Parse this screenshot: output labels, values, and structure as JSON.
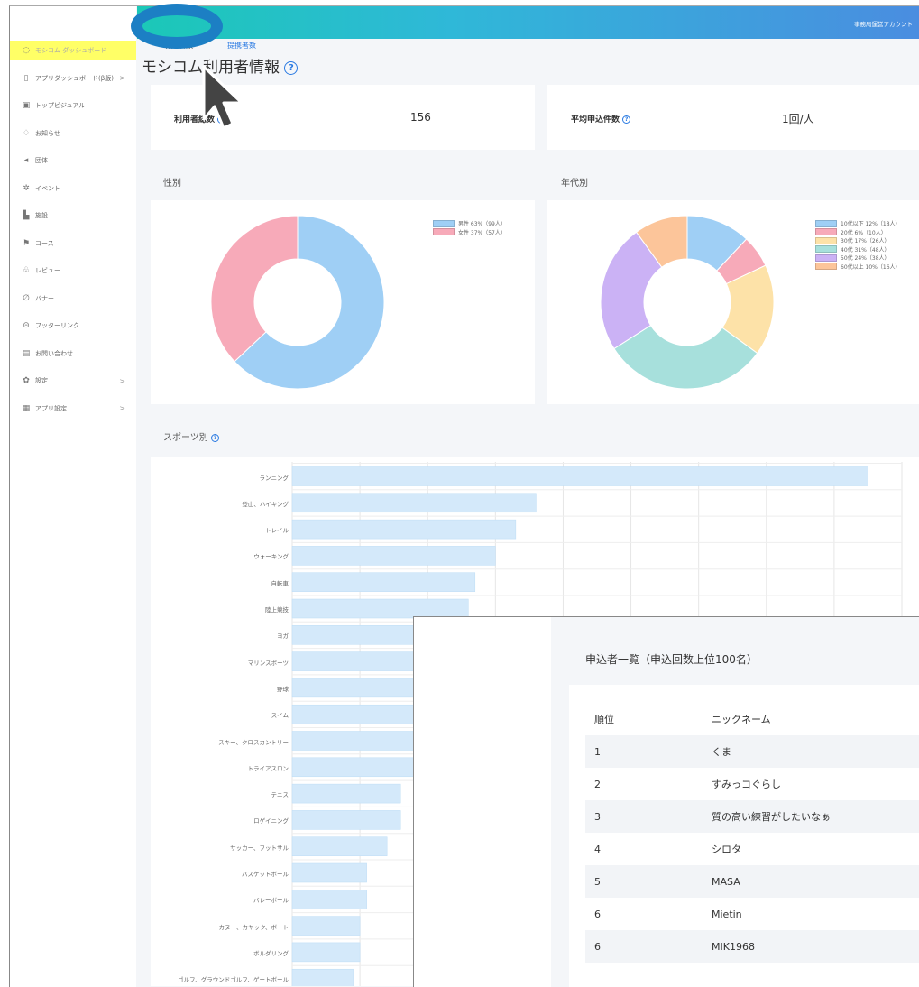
{
  "header": {
    "account": "事務局運営アカウント"
  },
  "tabs": [
    "利用者数",
    "提携者数"
  ],
  "sidebar": {
    "items": [
      {
        "label": "モシコム ダッシュボード",
        "icon": "dashboard-icon",
        "active": true
      },
      {
        "label": "アプリダッシュボード(β版)",
        "icon": "mobile-icon",
        "chevron": ">"
      },
      {
        "label": "トップビジュアル",
        "icon": "image-icon"
      },
      {
        "label": "お知らせ",
        "icon": "bell-icon"
      },
      {
        "label": "団体",
        "icon": "megaphone-icon"
      },
      {
        "label": "イベント",
        "icon": "event-icon"
      },
      {
        "label": "施設",
        "icon": "building-icon"
      },
      {
        "label": "コース",
        "icon": "flag-icon"
      },
      {
        "label": "レビュー",
        "icon": "thumbs-up-icon"
      },
      {
        "label": "バナー",
        "icon": "clip-icon"
      },
      {
        "label": "フッターリンク",
        "icon": "link-icon"
      },
      {
        "label": "お問い合わせ",
        "icon": "mail-icon"
      },
      {
        "label": "設定",
        "icon": "gear-icon",
        "chevron": ">"
      },
      {
        "label": "アプリ設定",
        "icon": "grid-icon",
        "chevron": ">"
      }
    ]
  },
  "page": {
    "title": "モシコム利用者情報"
  },
  "stats": {
    "total_label": "利用者総数",
    "total_value": "156",
    "avg_label": "平均申込件数",
    "avg_value": "1回/人"
  },
  "sections": {
    "gender": "性別",
    "age": "年代別",
    "sports": "スポーツ別"
  },
  "colors": {
    "male": "#9fcff5",
    "female": "#f7aab9",
    "teen": "#9fcff5",
    "twenties": "#f7aab9",
    "thirties": "#fde2a8",
    "forties": "#a7e0dc",
    "fifties": "#cbb2f5",
    "sixties": "#fcc59a"
  },
  "chart_data": [
    {
      "type": "pie",
      "title": "性別",
      "categories": [
        "男性",
        "女性"
      ],
      "values": [
        63,
        37
      ],
      "counts": [
        99,
        57
      ],
      "legend": [
        "男性 63%（99人）",
        "女性 37%（57人）"
      ],
      "colors": [
        "#9fcff5",
        "#f7aab9"
      ]
    },
    {
      "type": "pie",
      "title": "年代別",
      "categories": [
        "10代以下",
        "20代",
        "30代",
        "40代",
        "50代",
        "60代以上"
      ],
      "values": [
        12,
        6,
        17,
        31,
        24,
        10
      ],
      "counts": [
        18,
        10,
        26,
        48,
        38,
        16
      ],
      "legend": [
        "10代以下 12%（18人）",
        "20代 6%（10人）",
        "30代 17%（26人）",
        "40代 31%（48人）",
        "50代 24%（38人）",
        "60代以上 10%（16人）"
      ],
      "colors": [
        "#9fcff5",
        "#f7aab9",
        "#fde2a8",
        "#a7e0dc",
        "#cbb2f5",
        "#fcc59a"
      ]
    },
    {
      "type": "bar",
      "title": "スポーツ別",
      "orientation": "horizontal",
      "categories": [
        "ランニング",
        "登山、ハイキング",
        "トレイル",
        "ウォーキング",
        "自転車",
        "陸上競技",
        "ヨガ",
        "マリンスポーツ",
        "野球",
        "スイム",
        "スキー、クロスカントリー",
        "トライアスロン",
        "テニス",
        "ロゲイニング",
        "サッカー、フットサル",
        "バスケットボール",
        "バレーボール",
        "カヌー、カヤック、ボート",
        "ボルダリング",
        "ゴルフ、グラウンドゴルフ、ゲートボール"
      ],
      "values": [
        85,
        36,
        33,
        30,
        27,
        26,
        25,
        24,
        23,
        22,
        21,
        20,
        16,
        16,
        14,
        11,
        11,
        10,
        10,
        9
      ],
      "xlim": [
        0,
        90
      ]
    }
  ],
  "applicants": {
    "title": "申込者一覧（申込回数上位100名）",
    "headers": [
      "順位",
      "ニックネーム"
    ],
    "rows": [
      [
        "1",
        "くま"
      ],
      [
        "2",
        "すみっコぐらし"
      ],
      [
        "3",
        "質の高い練習がしたいなぁ"
      ],
      [
        "4",
        "シロタ"
      ],
      [
        "5",
        "MASA"
      ],
      [
        "6",
        "Mietin"
      ],
      [
        "6",
        "MIK1968"
      ]
    ]
  }
}
